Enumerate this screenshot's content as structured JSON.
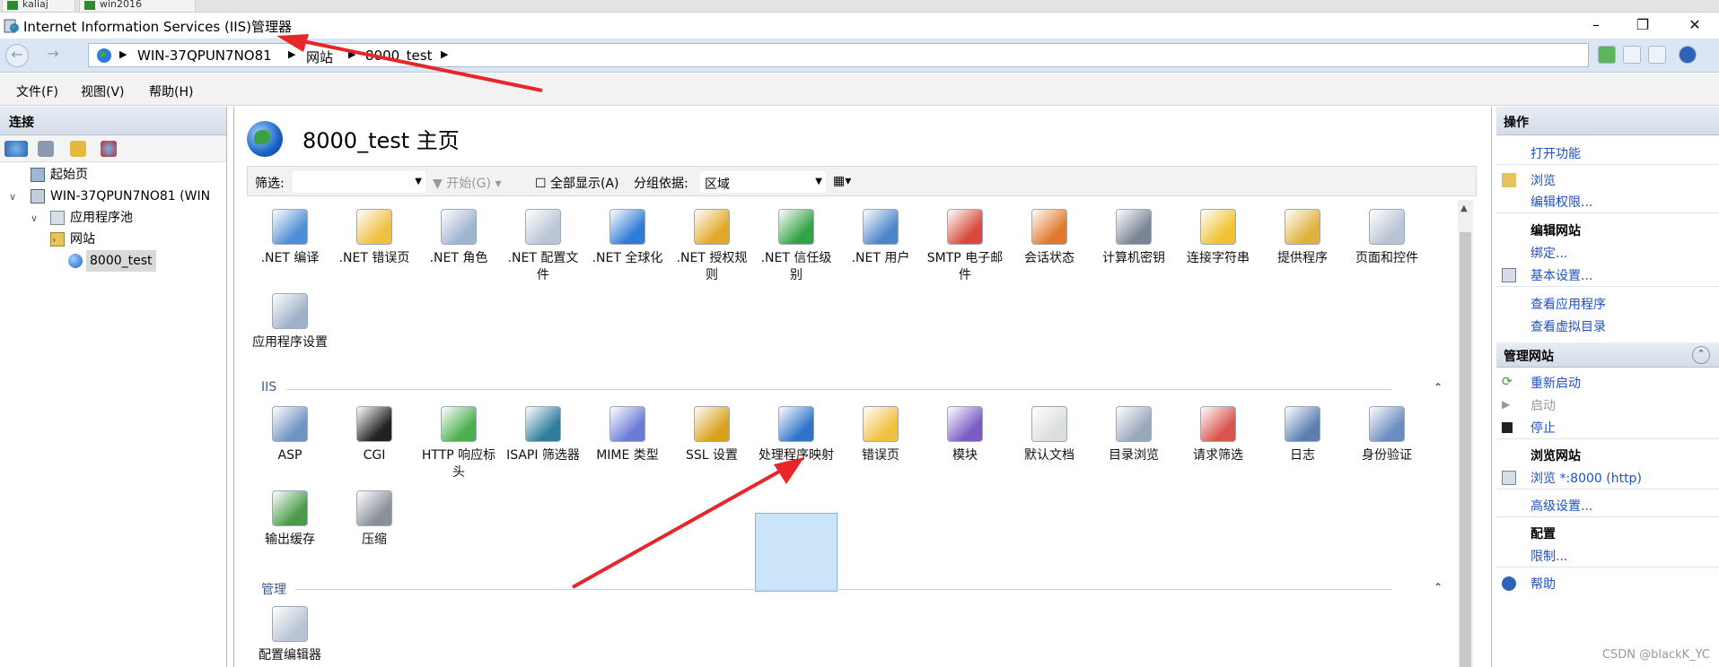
{
  "tabs": [
    {
      "label": "kaliaj"
    },
    {
      "label": "win2016"
    }
  ],
  "window": {
    "title": "Internet Information Services (IIS)管理器",
    "minimize": "–",
    "restore": "❐",
    "close": "✕"
  },
  "address": {
    "crumbs": [
      "WIN-37QPUN7NO81",
      "网站",
      "8000_test"
    ],
    "separator": "▶"
  },
  "menu": {
    "file": "文件(F)",
    "view": "视图(V)",
    "help": "帮助(H)"
  },
  "connections": {
    "title": "连接",
    "tree": {
      "start": "起始页",
      "server": "WIN-37QPUN7NO81 (WIN",
      "app_pools": "应用程序池",
      "sites": "网站",
      "site": "8000_test"
    }
  },
  "center": {
    "title": "8000_test 主页",
    "filter": {
      "label": "筛选:",
      "go": "开始(G)",
      "show_all": "全部显示(A)",
      "group_label": "分组依据:",
      "group_value": "区域"
    },
    "aspnet_items": [
      {
        "label": ".NET 编译",
        "icon": "dotnet-compile-icon"
      },
      {
        "label": ".NET 错误页",
        "icon": "dotnet-error-pages-icon"
      },
      {
        "label": ".NET 角色",
        "icon": "dotnet-roles-icon"
      },
      {
        "label": ".NET 配置文件",
        "icon": "dotnet-profile-icon"
      },
      {
        "label": ".NET 全球化",
        "icon": "dotnet-globalization-icon"
      },
      {
        "label": ".NET 授权规则",
        "icon": "dotnet-authorization-icon"
      },
      {
        "label": ".NET 信任级别",
        "icon": "dotnet-trust-icon"
      },
      {
        "label": ".NET 用户",
        "icon": "dotnet-users-icon"
      },
      {
        "label": "SMTP 电子邮件",
        "icon": "smtp-email-icon"
      },
      {
        "label": "会话状态",
        "icon": "session-state-icon"
      },
      {
        "label": "计算机密钥",
        "icon": "machine-key-icon"
      },
      {
        "label": "连接字符串",
        "icon": "connection-strings-icon"
      },
      {
        "label": "提供程序",
        "icon": "providers-icon"
      },
      {
        "label": "页面和控件",
        "icon": "pages-controls-icon"
      },
      {
        "label": "应用程序设置",
        "icon": "app-settings-icon"
      }
    ],
    "iis_group": "IIS",
    "iis_items": [
      {
        "label": "ASP",
        "icon": "asp-icon"
      },
      {
        "label": "CGI",
        "icon": "cgi-icon"
      },
      {
        "label": "HTTP 响应标头",
        "icon": "http-headers-icon"
      },
      {
        "label": "ISAPI 筛选器",
        "icon": "isapi-filters-icon"
      },
      {
        "label": "MIME 类型",
        "icon": "mime-types-icon"
      },
      {
        "label": "SSL 设置",
        "icon": "ssl-settings-icon"
      },
      {
        "label": "处理程序映射",
        "icon": "handler-mappings-icon"
      },
      {
        "label": "错误页",
        "icon": "error-pages-icon"
      },
      {
        "label": "模块",
        "icon": "modules-icon"
      },
      {
        "label": "默认文档",
        "icon": "default-document-icon"
      },
      {
        "label": "目录浏览",
        "icon": "directory-browsing-icon"
      },
      {
        "label": "请求筛选",
        "icon": "request-filtering-icon"
      },
      {
        "label": "日志",
        "icon": "logging-icon"
      },
      {
        "label": "身份验证",
        "icon": "authentication-icon"
      },
      {
        "label": "输出缓存",
        "icon": "output-caching-icon"
      },
      {
        "label": "压缩",
        "icon": "compression-icon"
      }
    ],
    "manage_group": "管理",
    "manage_items": [
      {
        "label": "配置编辑器",
        "icon": "config-editor-icon"
      }
    ]
  },
  "actions": {
    "title": "操作",
    "open_feature": "打开功能",
    "browse": "浏览",
    "edit_permissions": "编辑权限...",
    "edit_site": "编辑网站",
    "bindings": "绑定...",
    "basic_settings": "基本设置...",
    "view_apps": "查看应用程序",
    "view_vdirs": "查看虚拟目录",
    "manage_site": "管理网站",
    "restart": "重新启动",
    "start": "启动",
    "stop": "停止",
    "browse_site": "浏览网站",
    "browse_8000": "浏览 *:8000 (http)",
    "advanced": "高级设置...",
    "config": "配置",
    "limits": "限制...",
    "help": "帮助"
  },
  "watermark": "CSDN @blackK_YC",
  "colors": {
    "link": "#1e50c8",
    "selection": "#cce4f7",
    "annotation_arrow": "#e8262a"
  }
}
